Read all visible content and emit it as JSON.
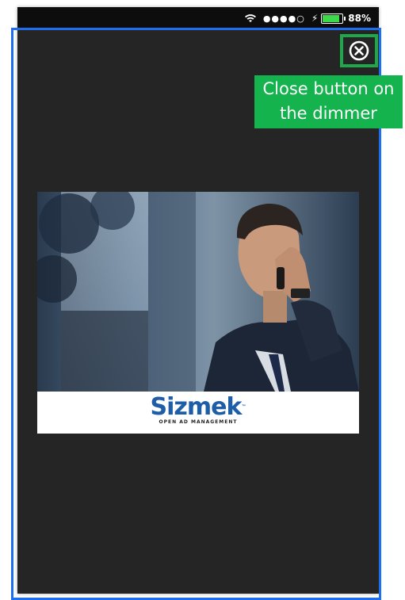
{
  "status_bar": {
    "signal": "●●●●○",
    "charging_icon": "⚡",
    "battery_percent": "88%",
    "battery_level": 0.88,
    "battery_color": "#3cd94a"
  },
  "close_button": {
    "icon": "close-circle-icon",
    "label": "⊗"
  },
  "callout": {
    "text_line1": "Close button on",
    "text_line2": "the dimmer",
    "color": "#14b34e"
  },
  "ad": {
    "brand": "Sizmek",
    "trademark": "™",
    "tagline": "OPEN AD MANAGEMENT",
    "brand_color": "#1e5ea8"
  },
  "colors": {
    "dimmer": "#252525",
    "outline": "#1d6ff0",
    "close_outline": "#1fa84a"
  }
}
